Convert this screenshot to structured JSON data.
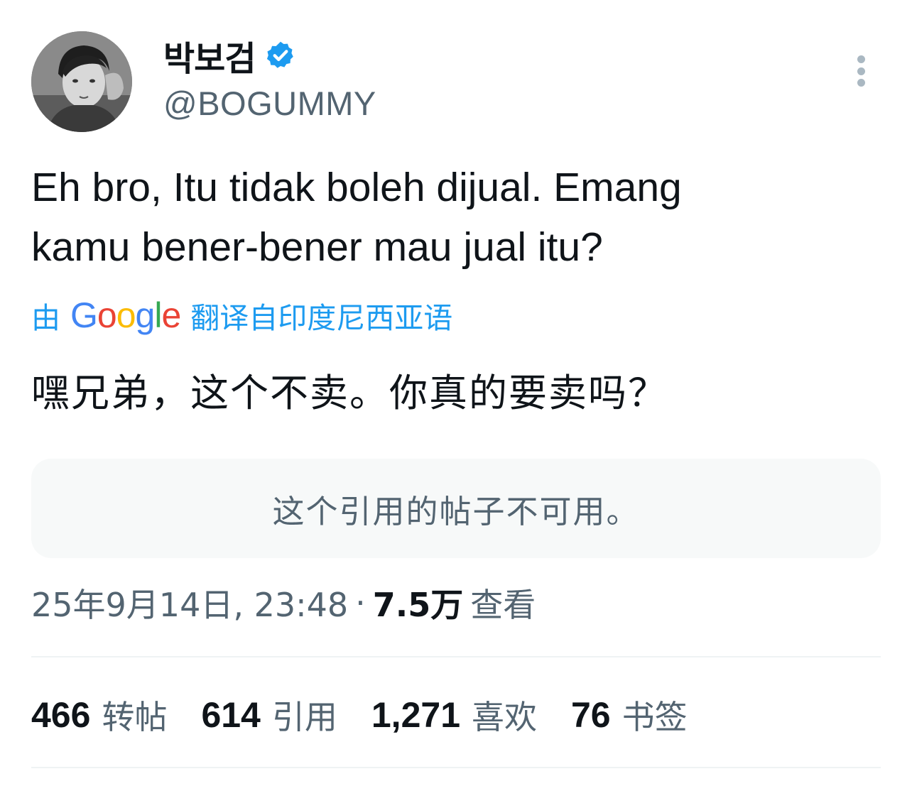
{
  "author": {
    "display_name": "박보검",
    "handle": "@BOGUMMY",
    "verified": true
  },
  "tweet": {
    "text_lines": [
      "Eh bro, Itu tidak boleh dijual. Emang",
      "kamu bener-bener mau jual itu?"
    ],
    "translation_prefix": "由",
    "translation_provider": "Google",
    "translation_suffix": "翻译自印度尼西亚语",
    "translated_text": "嘿兄弟，这个不卖。你真的要卖吗？",
    "quoted_unavailable": "这个引用的帖子不可用。"
  },
  "meta": {
    "timestamp": "25年9月14日, 23:48",
    "separator": "·",
    "views_count": "7.5万",
    "views_label": "查看"
  },
  "stats": {
    "retweets": {
      "count": "466",
      "label": "转帖"
    },
    "quotes": {
      "count": "614",
      "label": "引用"
    },
    "likes": {
      "count": "1,271",
      "label": "喜欢"
    },
    "bookmarks": {
      "count": "76",
      "label": "书签"
    }
  },
  "colors": {
    "accent": "#1d9bf0",
    "secondary_text": "#536471",
    "primary_text": "#0f1419"
  },
  "icons": {
    "verified": "verified-badge-icon",
    "more": "more-options-icon"
  }
}
